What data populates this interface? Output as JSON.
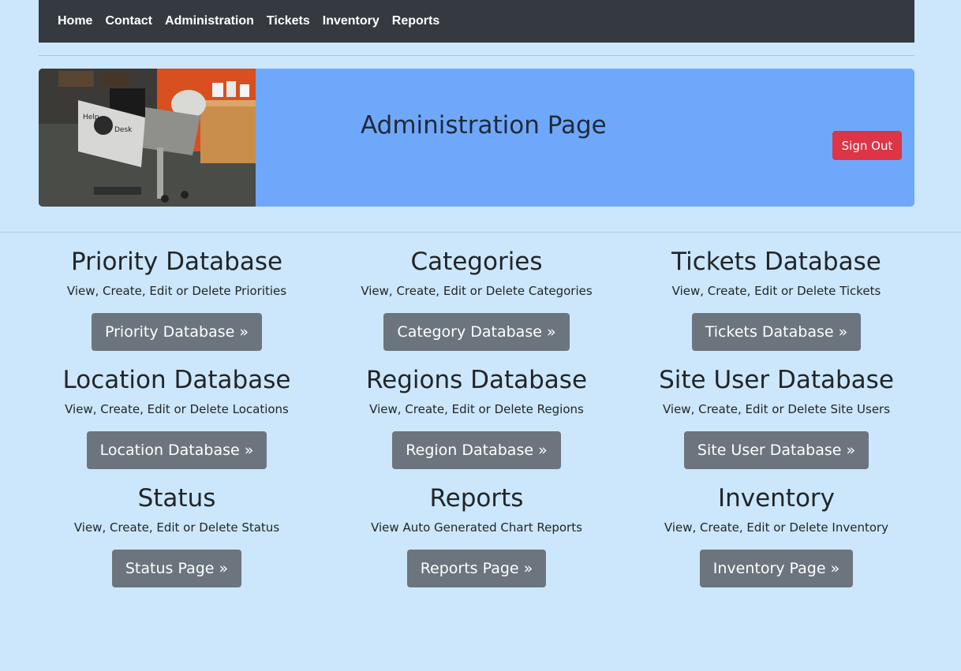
{
  "nav": {
    "items": [
      {
        "label": "Home"
      },
      {
        "label": "Contact"
      },
      {
        "label": "Administration"
      },
      {
        "label": "Tickets"
      },
      {
        "label": "Inventory"
      },
      {
        "label": "Reports"
      }
    ]
  },
  "hero": {
    "title": "Administration Page",
    "signout_label": "Sign Out",
    "image_icon": "help-desk-photo",
    "sign_text_help": "Help",
    "sign_text_desk": "Desk"
  },
  "colors": {
    "page_bg": "#cce7fb",
    "navbar_bg": "#343a40",
    "hero_bg": "#6fa8fb",
    "signout_bg": "#dc3545",
    "button_bg": "#6c757d"
  },
  "cards": [
    {
      "title": "Priority Database",
      "desc": "View, Create, Edit or Delete Priorities",
      "button": "Priority Database »"
    },
    {
      "title": "Categories",
      "desc": "View, Create, Edit or Delete Categories",
      "button": "Category Database »"
    },
    {
      "title": "Tickets Database",
      "desc": "View, Create, Edit or Delete Tickets",
      "button": "Tickets Database »"
    },
    {
      "title": "Location Database",
      "desc": "View, Create, Edit or Delete Locations",
      "button": "Location Database »"
    },
    {
      "title": "Regions Database",
      "desc": "View, Create, Edit or Delete Regions",
      "button": "Region Database »"
    },
    {
      "title": "Site User Database",
      "desc": "View, Create, Edit or Delete Site Users",
      "button": "Site User Database »"
    },
    {
      "title": "Status",
      "desc": "View, Create, Edit or Delete Status",
      "button": "Status Page »"
    },
    {
      "title": "Reports",
      "desc": "View Auto Generated Chart Reports",
      "button": "Reports Page »"
    },
    {
      "title": "Inventory",
      "desc": "View, Create, Edit or Delete Inventory",
      "button": "Inventory Page »"
    }
  ]
}
